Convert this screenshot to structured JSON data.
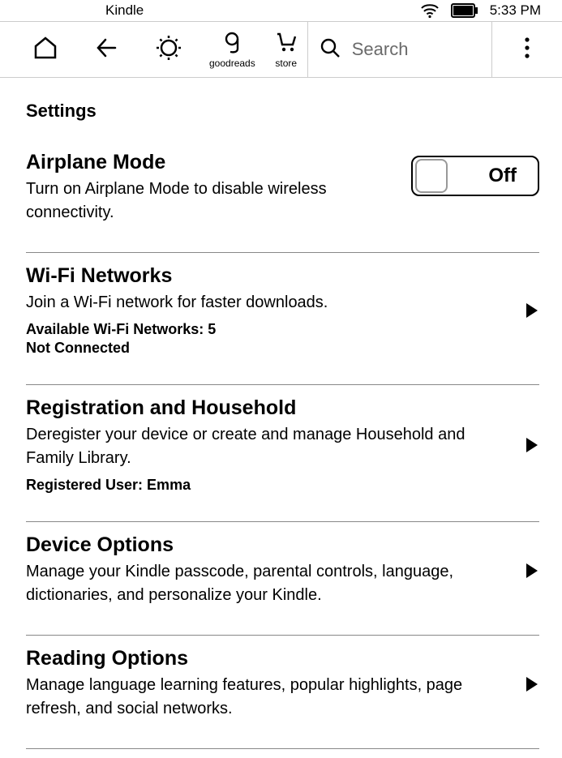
{
  "status": {
    "app_name": "Kindle",
    "time": "5:33 PM"
  },
  "toolbar": {
    "goodreads_label": "goodreads",
    "store_label": "store",
    "search_placeholder": "Search"
  },
  "page": {
    "title": "Settings"
  },
  "settings": {
    "airplane": {
      "title": "Airplane Mode",
      "desc": "Turn on Airplane Mode to disable wireless connectivity.",
      "toggle_label": "Off"
    },
    "wifi": {
      "title": "Wi-Fi Networks",
      "desc": "Join a Wi-Fi network for faster downloads.",
      "meta1": "Available Wi-Fi Networks: 5",
      "meta2": "Not Connected"
    },
    "registration": {
      "title": "Registration and Household",
      "desc": "Deregister your device or create and manage Household and Family Library.",
      "meta1": "Registered User: Emma"
    },
    "device": {
      "title": "Device Options",
      "desc": "Manage your Kindle passcode, parental controls, language, dictionaries, and personalize your Kindle."
    },
    "reading": {
      "title": "Reading Options",
      "desc": "Manage language learning features, popular highlights, page refresh, and social networks."
    }
  }
}
